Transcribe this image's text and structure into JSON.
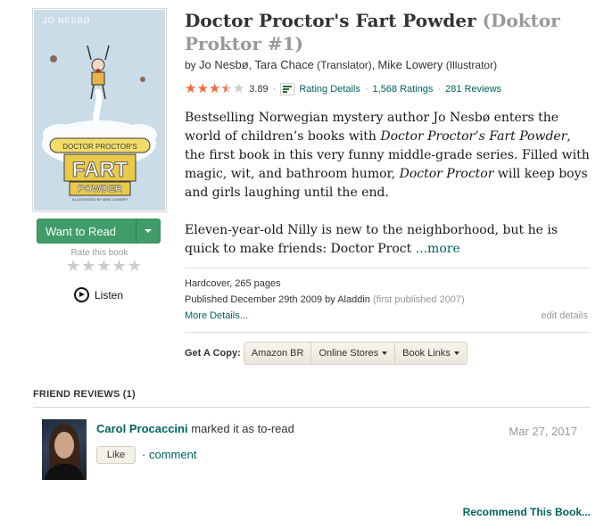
{
  "cover": {
    "author_text": "JO NESBØ",
    "logo_line1": "DOCTOR PROCTOR'S",
    "logo_line2": "FART",
    "logo_line3": "POWDER",
    "logo_small": "ILLUSTRATED BY MIKE LOWERY"
  },
  "shelf": {
    "want_label": "Want to Read",
    "rate_label": "Rate this book",
    "listen_label": "Listen"
  },
  "book": {
    "title": "Doctor Proctor's Fart Powder",
    "series": "(Doktor Proktor #1)",
    "by": "by",
    "authors": [
      {
        "name": "Jo Nesbø",
        "role": ""
      },
      {
        "name": "Tara Chace",
        "role": "(Translator)"
      },
      {
        "name": "Mike Lowery",
        "role": "(Illustrator)"
      }
    ],
    "rating": 3.89,
    "avg_text": "3.89",
    "rating_details": "Rating Details",
    "ratings_count": "1,568 Ratings",
    "reviews_count": "281 Reviews",
    "colors": {
      "star": "#f26a3f",
      "link": "#00635d",
      "button": "#409d69"
    }
  },
  "description": {
    "p1_a": "Bestselling Norwegian mystery author Jo Nesbø enters the world of children’s books with ",
    "p1_em1": "Doctor Proctor’s Fart Powder",
    "p1_b": ", the first book in this very funny middle-grade series. Filled with magic, wit, and bathroom humor, ",
    "p1_em2": "Doctor Proctor",
    "p1_c": " will keep boys and girls laughing until the end.",
    "p2": "Eleven-year-old Nilly is new to the neighborhood, but he is quick to make friends: Doctor Proct ",
    "more": "...more"
  },
  "details": {
    "format": "Hardcover, 265 pages",
    "published": "Published December 29th 2009 by Aladdin",
    "first_published": "(first published 2007)",
    "more_details": "More Details...",
    "edit_details": "edit details"
  },
  "get_copy": {
    "label": "Get A Copy:",
    "buttons": [
      "Amazon BR",
      "Online Stores",
      "Book Links"
    ]
  },
  "friend_reviews": {
    "header": "FRIEND REVIEWS (1)",
    "reviewer": "Carol Procaccini",
    "action": "marked it as to-read",
    "date": "Mar 27, 2017",
    "like": "Like",
    "dot": "·",
    "comment": "comment"
  },
  "recommend": "Recommend This Book..."
}
